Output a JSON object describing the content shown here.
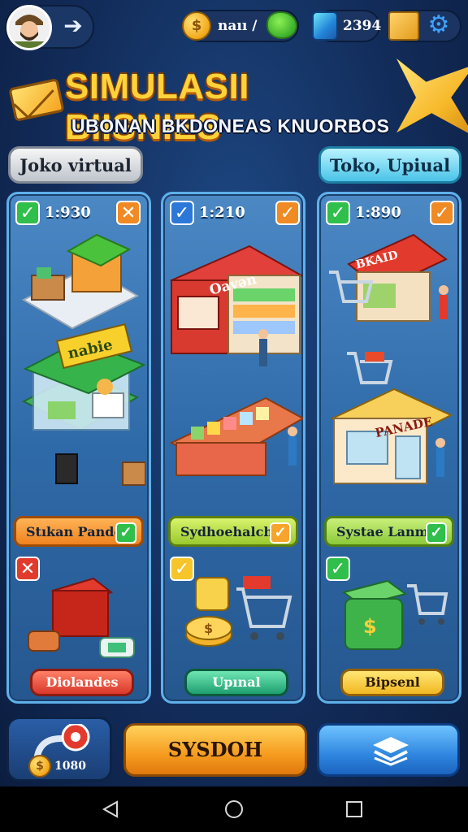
{
  "topbar": {
    "back_icon": "arrow-left-icon",
    "coins_value": "naıı /",
    "coin_glyph": "$",
    "gems_value": "2394",
    "settings_icon": "gear-icon"
  },
  "banner": {
    "title": "SIMULASII BIISNIES",
    "subtitle": "UBONAN BKDONEAS KNUORBOS"
  },
  "tabs": {
    "left_label": "Joko virtual",
    "right_label": "Toko, Upiual"
  },
  "cards": [
    {
      "price": "1:930",
      "top_check": "✓",
      "top_badge": "✕",
      "sign_text": "nabie",
      "label": "Stıkan Pande",
      "bottom_mark": "✕",
      "button": "Diolandes",
      "button_style": "red"
    },
    {
      "price": "1:210",
      "top_check": "✓",
      "top_badge": "✓",
      "sign_text": "Oavən",
      "label": "Sydhoehalch",
      "bottom_mark": "✓",
      "button": "Upınal",
      "button_style": "green"
    },
    {
      "price": "1:890",
      "top_check": "✓",
      "top_badge": "✓",
      "sign_text": "BKAID",
      "sign_text_2": "PANADE",
      "label": "Systae Lanm",
      "bottom_mark": "✓",
      "button": "Bipsenl",
      "button_style": "yellow"
    }
  ],
  "bottom": {
    "counter": "1080",
    "main_button": "SYSDOH",
    "right_button_icon": "stack-icon"
  },
  "colors": {
    "background": "#143266",
    "title_gold": "#ffd23a",
    "card_blue": "#2f6aa8",
    "accent_orange": "#f59b1f",
    "accent_blue": "#2f86df"
  }
}
